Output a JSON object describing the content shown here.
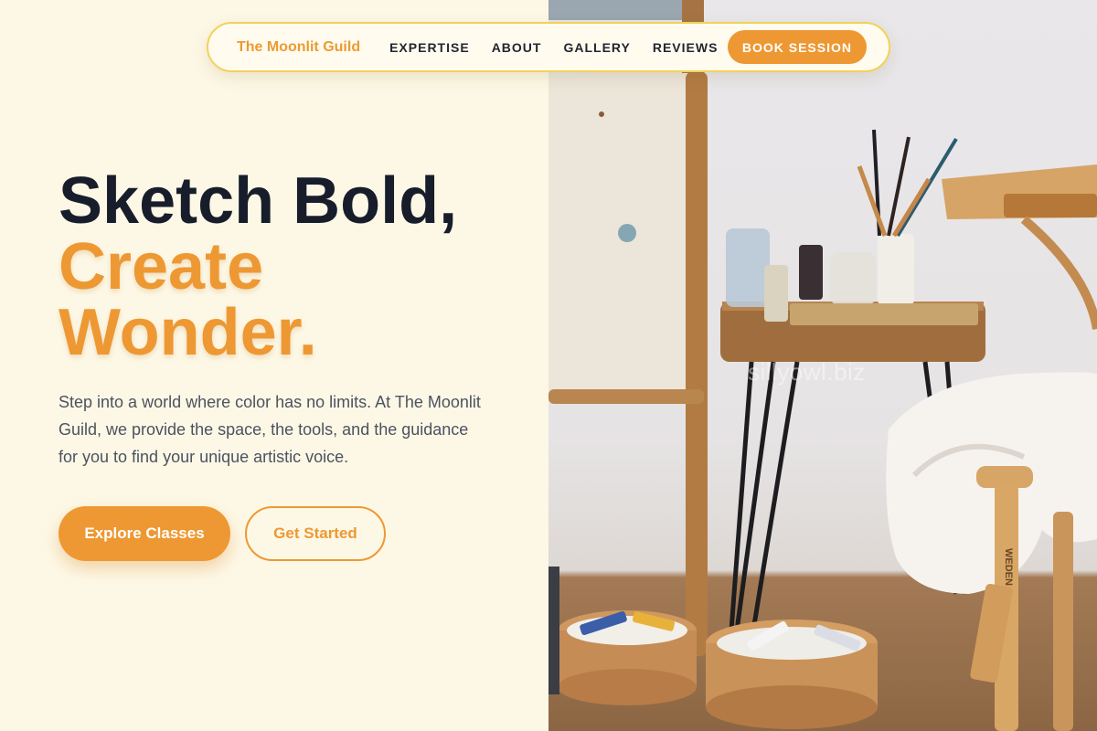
{
  "nav": {
    "brand": "The Moonlit Guild",
    "links": [
      "EXPERTISE",
      "ABOUT",
      "GALLERY",
      "REVIEWS"
    ],
    "cta": "BOOK SESSION"
  },
  "hero": {
    "title_line1": "Sketch Bold,",
    "title_line2": "Create",
    "title_line3": "Wonder.",
    "description": "Step into a world where color has no limits. At The Moonlit Guild, we provide the space, the tools, and the guidance for you to find your unique artistic voice.",
    "primary_button": "Explore Classes",
    "secondary_button": "Get Started"
  },
  "photo": {
    "watermark": "sillyowl.biz",
    "stool_label": "WEDEN"
  },
  "colors": {
    "accent": "#ee9833",
    "page_background": "#fdf8e6",
    "heading": "#181d2b",
    "nav_border": "#f2d25a"
  }
}
